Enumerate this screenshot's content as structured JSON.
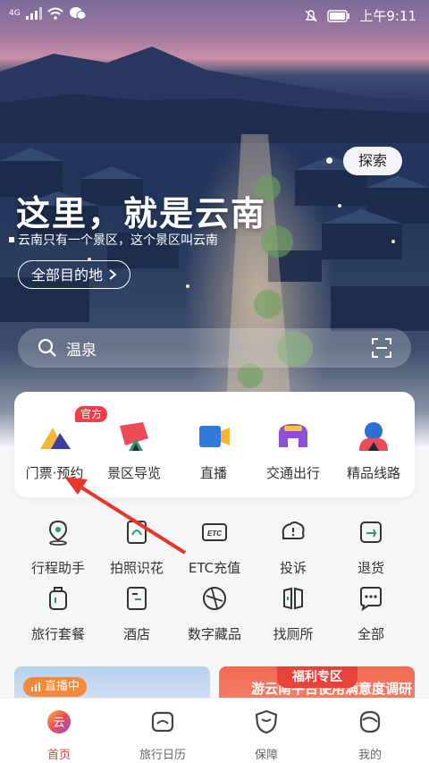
{
  "status_bar": {
    "network": "4G",
    "time": "上午9:11"
  },
  "hero": {
    "explore_label": "探索",
    "title": "这里，就是云南",
    "subtitle": "云南只有一个景区，这个景区叫云南",
    "destinations_label": "全部目的地"
  },
  "search": {
    "text": "温泉"
  },
  "main_services": {
    "official_badge": "官方",
    "items": [
      {
        "label": "门票·预约",
        "icon": "ticket-icon"
      },
      {
        "label": "景区导览",
        "icon": "guide-icon"
      },
      {
        "label": "直播",
        "icon": "live-camera-icon"
      },
      {
        "label": "交通出行",
        "icon": "transport-icon"
      },
      {
        "label": "精品线路",
        "icon": "route-icon"
      }
    ]
  },
  "grid": {
    "row1": [
      {
        "label": "行程助手",
        "icon": "location-pin-icon"
      },
      {
        "label": "拍照识花",
        "icon": "photo-flower-icon"
      },
      {
        "label": "ETC充值",
        "icon": "etc-icon"
      },
      {
        "label": "投诉",
        "icon": "complaint-icon"
      },
      {
        "label": "退货",
        "icon": "return-icon"
      }
    ],
    "row2": [
      {
        "label": "旅行套餐",
        "icon": "luggage-icon"
      },
      {
        "label": "酒店",
        "icon": "hotel-icon"
      },
      {
        "label": "数字藏品",
        "icon": "digital-collection-icon"
      },
      {
        "label": "找厕所",
        "icon": "toilet-icon"
      },
      {
        "label": "全部",
        "icon": "more-icon"
      }
    ]
  },
  "banners": {
    "live_label": "直播中",
    "welfare_label": "福利专区",
    "survey_text": "游云南平台使用满意度调研"
  },
  "tabs": [
    {
      "label": "首页",
      "icon": "home-icon"
    },
    {
      "label": "旅行日历",
      "icon": "calendar-icon"
    },
    {
      "label": "保障",
      "icon": "shield-icon"
    },
    {
      "label": "我的",
      "icon": "profile-icon"
    }
  ],
  "colors": {
    "accent": "#e0453b",
    "badge": "#f0404d",
    "arrow": "#e8362d"
  }
}
